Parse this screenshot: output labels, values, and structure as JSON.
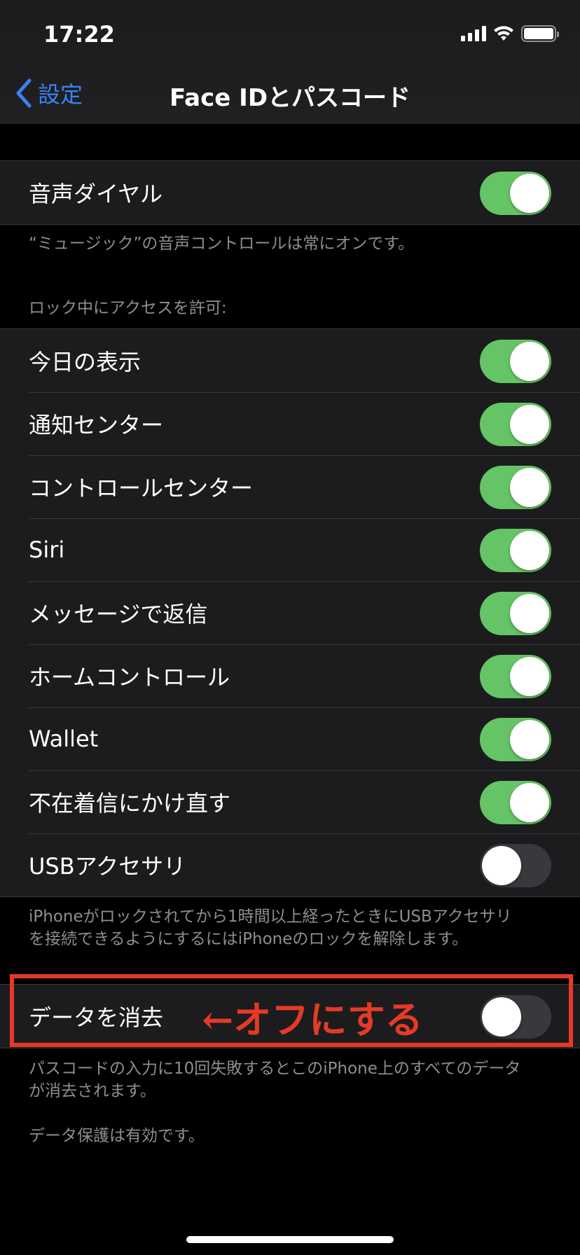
{
  "status_bar": {
    "time": "17:22",
    "icons": [
      "signal-icon",
      "wifi-icon",
      "battery-icon"
    ]
  },
  "nav": {
    "back_label": "設定",
    "title": "Face IDとパスコード"
  },
  "voice_dial": {
    "label": "音声ダイヤル",
    "on": true,
    "footer": "“ミュージック”の音声コントロールは常にオンです。"
  },
  "lock_access": {
    "header": "ロック中にアクセスを許可:",
    "items": [
      {
        "label": "今日の表示",
        "on": true
      },
      {
        "label": "通知センター",
        "on": true
      },
      {
        "label": "コントロールセンター",
        "on": true
      },
      {
        "label": "Siri",
        "on": true
      },
      {
        "label": "メッセージで返信",
        "on": true
      },
      {
        "label": "ホームコントロール",
        "on": true
      },
      {
        "label": "Wallet",
        "on": true
      },
      {
        "label": "不在着信にかけ直す",
        "on": true
      },
      {
        "label": "USBアクセサリ",
        "on": false
      }
    ],
    "footer_line1": "iPhoneがロックされてから1時間以上経ったときにUSBアクセサリ",
    "footer_line2": "を接続できるようにするにはiPhoneのロックを解除します。"
  },
  "erase_data": {
    "label": "データを消去",
    "on": false,
    "footer_line1": "パスコードの入力に10回失敗するとこのiPhone上のすべてのデータ",
    "footer_line2": "が消去されます。",
    "footer_line3": "データ保護は有効です。"
  },
  "annotation": {
    "text": "←オフにする",
    "color": "#e63a26"
  },
  "colors": {
    "accent": "#3a82f7",
    "toggle_on": "#65c466",
    "toggle_off": "#39393d"
  }
}
